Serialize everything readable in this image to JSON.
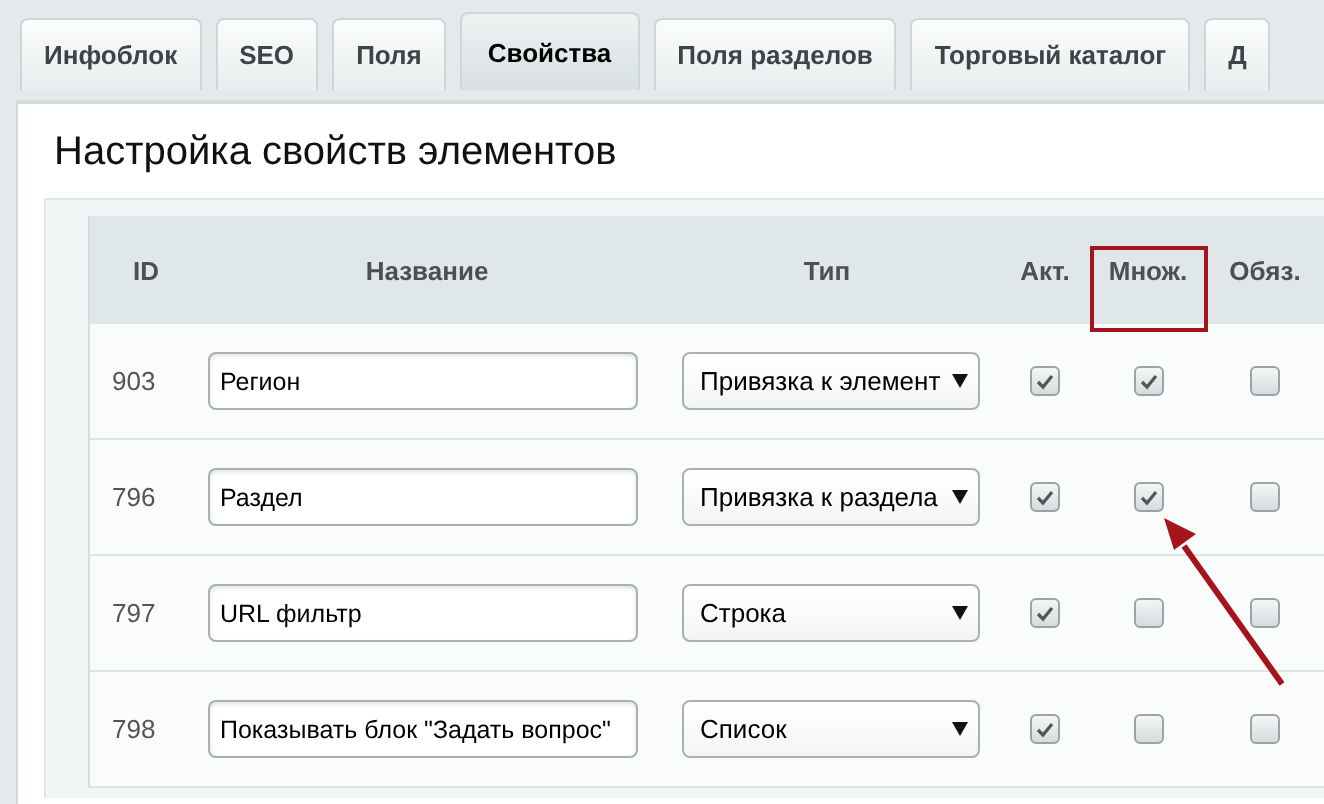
{
  "tabs": [
    {
      "label": "Инфоблок",
      "selected": false
    },
    {
      "label": "SEO",
      "selected": false
    },
    {
      "label": "Поля",
      "selected": false
    },
    {
      "label": "Свойства",
      "selected": true
    },
    {
      "label": "Поля разделов",
      "selected": false
    },
    {
      "label": "Торговый каталог",
      "selected": false
    },
    {
      "label": "Д",
      "selected": false
    }
  ],
  "title": "Настройка свойств элементов",
  "table": {
    "columns": [
      {
        "label": "ID",
        "highlighted": false
      },
      {
        "label": "Название",
        "highlighted": false
      },
      {
        "label": "Тип",
        "highlighted": false
      },
      {
        "label": "Акт.",
        "highlighted": false
      },
      {
        "label": "Множ.",
        "highlighted": true
      },
      {
        "label": "Обяз.",
        "highlighted": false
      }
    ],
    "rows": [
      {
        "id": "903",
        "name": "Регион",
        "type": "Привязка к элемент",
        "active": true,
        "multiple": true,
        "required": false
      },
      {
        "id": "796",
        "name": "Раздел",
        "type": "Привязка к раздела",
        "active": true,
        "multiple": true,
        "required": false
      },
      {
        "id": "797",
        "name": "URL фильтр",
        "type": "Строка",
        "active": true,
        "multiple": false,
        "required": false
      },
      {
        "id": "798",
        "name": "Показывать блок \"Задать вопрос\"",
        "type": "Список",
        "active": true,
        "multiple": false,
        "required": false
      }
    ]
  }
}
